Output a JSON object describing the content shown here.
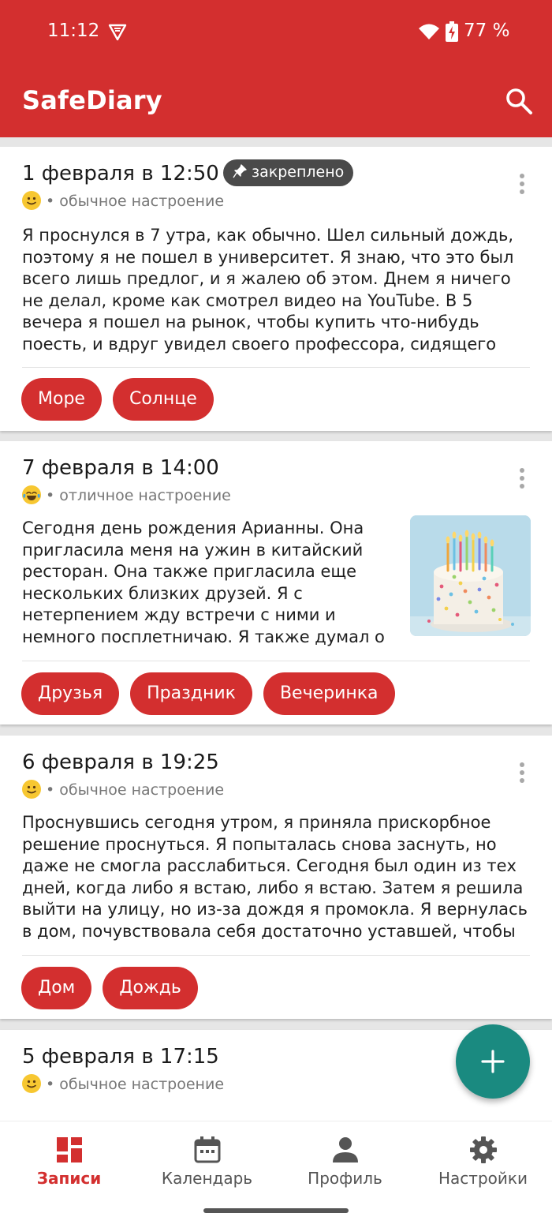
{
  "status_bar": {
    "time": "11:12",
    "battery": "77 %"
  },
  "app_bar": {
    "title": "SafeDiary"
  },
  "entries": [
    {
      "date": "1 февраля в 12:50",
      "pinned_label": "закреплено",
      "mood": "обычное настроение",
      "mood_emoji": "slightly-smiling-face",
      "text": "Я проснулся в 7 утра, как обычно. Шел сильный дождь, поэтому я не пошел в университет. Я знаю, что это был всего лишь предлог, и я жалею об этом. Днем я ничего не делал, кроме как смотрел видео на YouTube. В 5 вечера я пошел на рынок, чтобы купить что-нибудь поесть, и вдруг увидел своего профессора, сидящего напротив меня. М…",
      "tags": [
        "Море",
        "Солнце"
      ]
    },
    {
      "date": "7 февраля в 14:00",
      "mood": "отличное настроение",
      "mood_emoji": "face-with-tears-of-joy",
      "text": "Сегодня день рождения Арианны. Она пригласила меня на ужин в китайский ресторан. Она также пригласила еще нескольких близких друзей. Я с нетерпением жду встречи с ними и немного посплетничаю. Я также думал о …",
      "tags": [
        "Друзья",
        "Праздник",
        "Вечеринка"
      ],
      "image": "birthday-cake"
    },
    {
      "date": "6 февраля в 19:25",
      "mood": "обычное настроение",
      "mood_emoji": "slightly-smiling-face",
      "text": "Проснувшись сегодня утром, я приняла прискорбное решение проснуться. Я попыталась снова заснуть, но даже не смогла расслабиться. Сегодня был один из тех дней, когда либо я встаю, либо я встаю. Затем я решила выйти на улицу, но из-за дождя я промокла. Я вернулась в дом, почувствовала себя достаточно уставшей, чтобы …",
      "tags": [
        "Дом",
        "Дождь"
      ]
    },
    {
      "date": "5 февраля в 17:15",
      "mood": "обычное настроение",
      "mood_emoji": "slightly-smiling-face"
    }
  ],
  "bottom_nav": [
    {
      "label": "Записи",
      "icon": "dashboard-icon",
      "active": true
    },
    {
      "label": "Календарь",
      "icon": "calendar-icon",
      "active": false
    },
    {
      "label": "Профиль",
      "icon": "person-icon",
      "active": false
    },
    {
      "label": "Настройки",
      "icon": "gear-icon",
      "active": false
    }
  ],
  "colors": {
    "primary": "#d32f2f",
    "fab": "#1a8a80",
    "pin_chip": "#4a4a4a"
  }
}
